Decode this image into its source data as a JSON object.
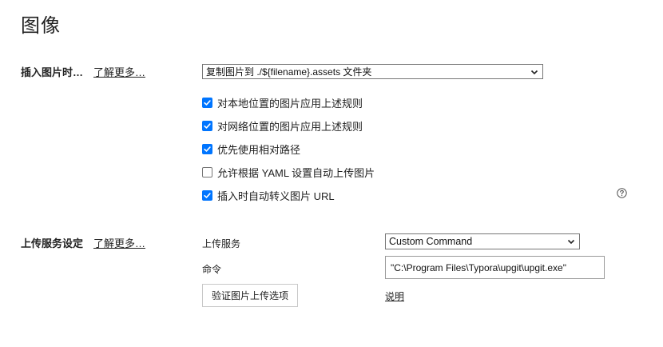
{
  "page": {
    "title": "图像"
  },
  "insert_section": {
    "label": "插入图片时…",
    "learn_more": "了解更多…",
    "select_value": "复制图片到 ./${filename}.assets 文件夹",
    "options": [
      {
        "label": "对本地位置的图片应用上述规则",
        "checked": true
      },
      {
        "label": "对网络位置的图片应用上述规则",
        "checked": true
      },
      {
        "label": "优先使用相对路径",
        "checked": true
      },
      {
        "label": "允许根据 YAML 设置自动上传图片",
        "checked": false
      },
      {
        "label": "插入时自动转义图片 URL",
        "checked": true
      }
    ],
    "help_icon": "question-circle-icon"
  },
  "upload_section": {
    "label": "上传服务设定",
    "learn_more": "了解更多…",
    "service_label": "上传服务",
    "service_value": "Custom Command",
    "command_label": "命令",
    "command_value": "\"C:\\Program Files\\Typora\\upgit\\upgit.exe\"",
    "verify_button": "验证图片上传选项",
    "explain_link": "说明"
  },
  "colors": {
    "checkbox_accent": "#0075ff",
    "text": "#222222"
  }
}
